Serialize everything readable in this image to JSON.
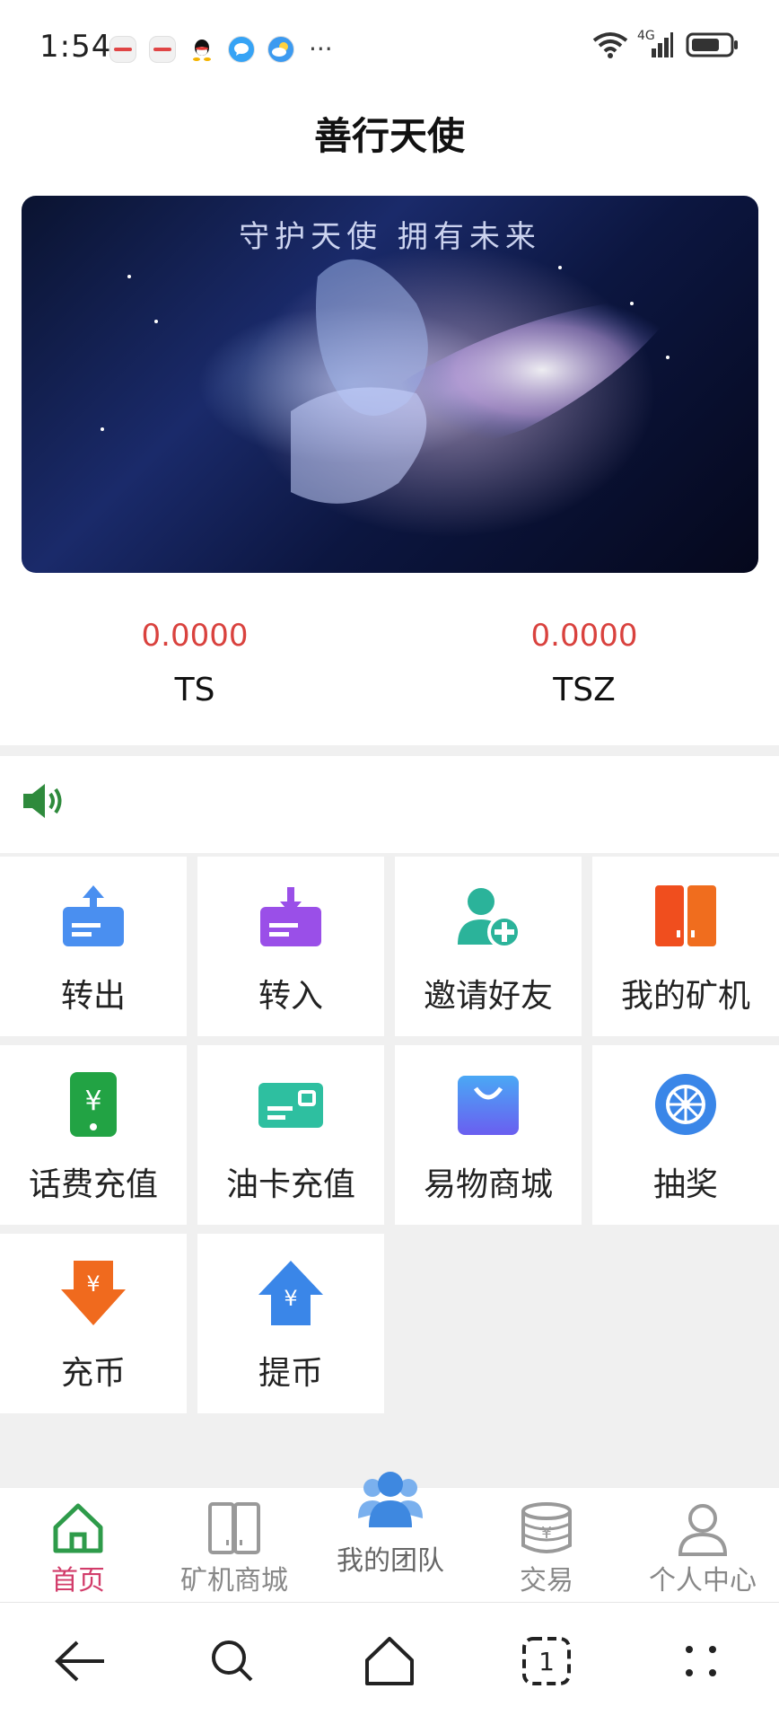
{
  "status": {
    "time": "1:54",
    "apps": [
      "huawei-app-icon",
      "huawei-app-icon",
      "qq-icon",
      "message-icon",
      "weather-icon"
    ],
    "more": "···",
    "network": "4G"
  },
  "header": {
    "title": "善行天使"
  },
  "banner": {
    "caption": "守护天使 拥有未来"
  },
  "balances": [
    {
      "value": "0.0000",
      "label": "TS"
    },
    {
      "value": "0.0000",
      "label": "TSZ"
    }
  ],
  "grid": [
    {
      "label": "转出",
      "icon": "transfer-out-icon"
    },
    {
      "label": "转入",
      "icon": "transfer-in-icon"
    },
    {
      "label": "邀请好友",
      "icon": "invite-friend-icon"
    },
    {
      "label": "我的矿机",
      "icon": "miner-icon"
    },
    {
      "label": "话费充值",
      "icon": "phone-recharge-icon"
    },
    {
      "label": "油卡充值",
      "icon": "fuel-card-icon"
    },
    {
      "label": "易物商城",
      "icon": "shopping-bag-icon"
    },
    {
      "label": "抽奖",
      "icon": "lottery-wheel-icon"
    },
    {
      "label": "充币",
      "icon": "deposit-coin-icon"
    },
    {
      "label": "提币",
      "icon": "withdraw-coin-icon"
    }
  ],
  "tabs": [
    {
      "label": "首页",
      "icon": "home-icon"
    },
    {
      "label": "矿机商城",
      "icon": "miner-mall-icon"
    },
    {
      "label": "我的团队",
      "icon": "team-icon"
    },
    {
      "label": "交易",
      "icon": "trade-coins-icon"
    },
    {
      "label": "个人中心",
      "icon": "user-icon"
    }
  ],
  "colors": {
    "accent": "#d23c6a",
    "balance": "#d9423e",
    "home_tab": "#2e9b4a",
    "team_tab": "#3e88e0",
    "notice_icon": "#2e8a3c"
  }
}
